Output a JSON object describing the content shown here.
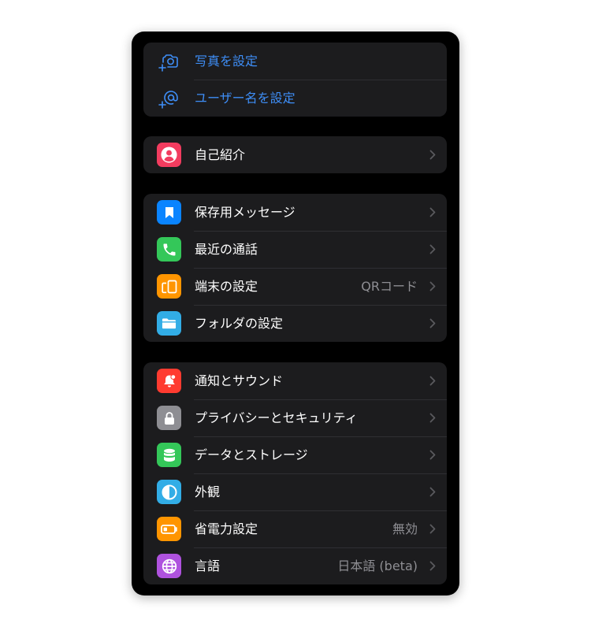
{
  "colors": {
    "page_bg": "#ffffff",
    "screen_bg": "#000000",
    "cell_bg": "#1c1c1e",
    "accent": "#3e8ef7",
    "secondary_text": "#8e8e93"
  },
  "profile_actions": [
    {
      "label": "写真を設定",
      "icon": "camera-plus-icon"
    },
    {
      "label": "ユーザー名を設定",
      "icon": "at-sign-plus-icon"
    }
  ],
  "bio": {
    "label": "自己紹介",
    "icon": "person-circle-icon",
    "icon_color": "#f23c5f"
  },
  "group_main": [
    {
      "label": "保存用メッセージ",
      "value": "",
      "icon": "bookmark-icon",
      "icon_color": "#0a84ff"
    },
    {
      "label": "最近の通話",
      "value": "",
      "icon": "phone-icon",
      "icon_color": "#34c759"
    },
    {
      "label": "端末の設定",
      "value": "QRコード",
      "icon": "devices-icon",
      "icon_color": "#ff9500"
    },
    {
      "label": "フォルダの設定",
      "value": "",
      "icon": "folder-icon",
      "icon_color": "#32ade6"
    }
  ],
  "group_settings": [
    {
      "label": "通知とサウンド",
      "value": "",
      "icon": "bell-icon",
      "icon_color": "#ff3b30"
    },
    {
      "label": "プライバシーとセキュリティ",
      "value": "",
      "icon": "lock-icon",
      "icon_color": "#8e8e93"
    },
    {
      "label": "データとストレージ",
      "value": "",
      "icon": "database-icon",
      "icon_color": "#34c759"
    },
    {
      "label": "外観",
      "value": "",
      "icon": "half-circle-icon",
      "icon_color": "#32ade6"
    },
    {
      "label": "省電力設定",
      "value": "無効",
      "icon": "battery-icon",
      "icon_color": "#ff9500"
    },
    {
      "label": "言語",
      "value": "日本語 (beta)",
      "icon": "globe-icon",
      "icon_color": "#af52de"
    }
  ]
}
